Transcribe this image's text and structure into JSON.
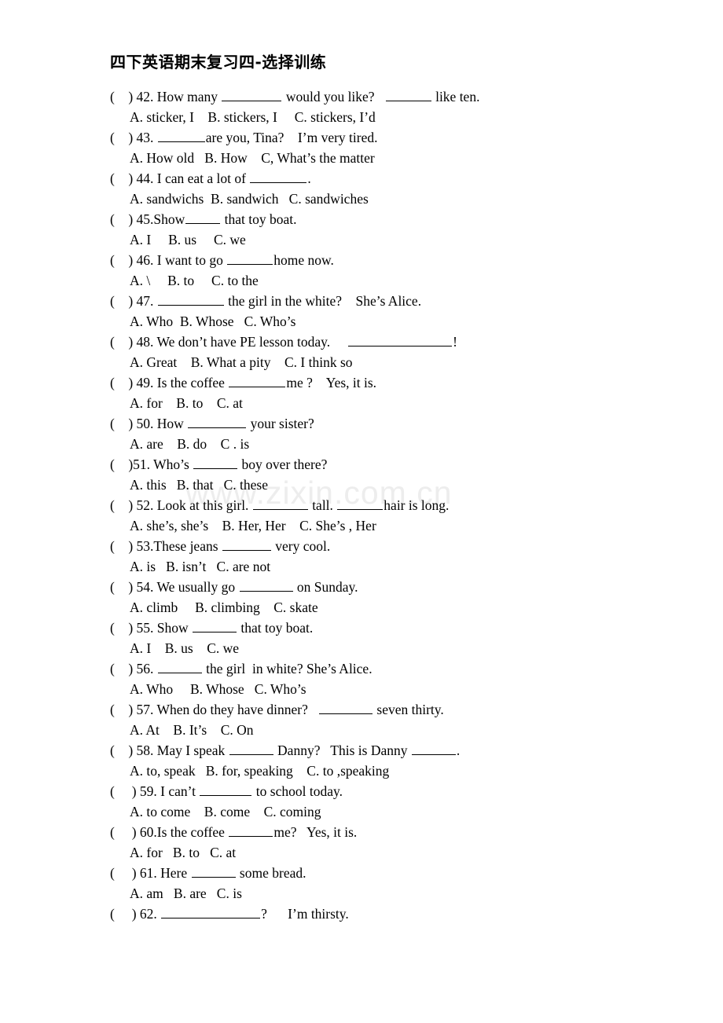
{
  "document": {
    "title": "四下英语期末复习四-选择训练",
    "watermark": "www.zixin.com.cn"
  },
  "questions": [
    {
      "marker": "(    ) ",
      "number": "42. ",
      "stem_a": "How many ",
      "blank1": 76,
      "stem_b": " would you like?   ",
      "blank2": 58,
      "stem_c": " like ten.",
      "options": "A. sticker, I    B. stickers, I     C. stickers, I’d"
    },
    {
      "marker": "(    ) ",
      "number": "43. ",
      "stem_a": "",
      "blank1": 60,
      "stem_b": "are you, Tina?    I’m very tired.",
      "blank2": 0,
      "stem_c": "",
      "options": "A. How old   B. How    C, What’s the matter"
    },
    {
      "marker": "(    ) ",
      "number": "44. ",
      "stem_a": "I can eat a lot of ",
      "blank1": 72,
      "stem_b": ".",
      "blank2": 0,
      "stem_c": "",
      "options": "A. sandwichs  B. sandwich   C. sandwiches"
    },
    {
      "marker": "(    ) ",
      "number": "45.",
      "stem_a": "Show",
      "blank1": 44,
      "stem_b": " that toy boat.",
      "blank2": 0,
      "stem_c": "",
      "options": "A. I     B. us     C. we"
    },
    {
      "marker": "(    ) ",
      "number": "46. ",
      "stem_a": "I want to go ",
      "blank1": 58,
      "stem_b": "home now.",
      "blank2": 0,
      "stem_c": "",
      "options": "A. \\     B. to     C. to the"
    },
    {
      "marker": "(    ) ",
      "number": "47. ",
      "stem_a": "",
      "blank1": 84,
      "stem_b": " the girl in the white?    She’s Alice.",
      "blank2": 0,
      "stem_c": "",
      "options": "A. Who  B. Whose   C. Who’s"
    },
    {
      "marker": "(    ) ",
      "number": "48. ",
      "stem_a": "We don’t have PE lesson today.     ",
      "blank1": 132,
      "stem_b": "!",
      "blank2": 0,
      "stem_c": "",
      "options": "A. Great    B. What a pity    C. I think so"
    },
    {
      "marker": "(    ) ",
      "number": "49. ",
      "stem_a": "Is the coffee ",
      "blank1": 72,
      "stem_b": "me ?    Yes, it is.",
      "blank2": 0,
      "stem_c": "",
      "options": "A. for    B. to    C. at"
    },
    {
      "marker": "(    ) ",
      "number": "50. ",
      "stem_a": "How ",
      "blank1": 74,
      "stem_b": " your sister?",
      "blank2": 0,
      "stem_c": "",
      "options": "A. are    B. do    C . is"
    },
    {
      "marker": "(    )",
      "number": "51. ",
      "stem_a": "Who’s ",
      "blank1": 56,
      "stem_b": " boy over there?",
      "blank2": 0,
      "stem_c": "",
      "options": "A. this   B. that   C. these"
    },
    {
      "marker": "(    ) ",
      "number": "52. ",
      "stem_a": "Look at this girl. ",
      "blank1": 70,
      "stem_b": " tall. ",
      "blank2": 58,
      "stem_c": "hair is long.",
      "options": "A. she’s, she’s    B. Her, Her    C. She’s , Her"
    },
    {
      "marker": "(    ) ",
      "number": "53.",
      "stem_a": "These jeans ",
      "blank1": 62,
      "stem_b": " very cool.",
      "blank2": 0,
      "stem_c": "",
      "options": "A. is   B. isn’t   C. are not"
    },
    {
      "marker": "(    ) ",
      "number": "54. ",
      "stem_a": "We usually go ",
      "blank1": 68,
      "stem_b": " on Sunday.",
      "blank2": 0,
      "stem_c": "",
      "options": "A. climb     B. climbing    C. skate"
    },
    {
      "marker": "(    ) ",
      "number": "55. ",
      "stem_a": "Show ",
      "blank1": 56,
      "stem_b": " that toy boat.",
      "blank2": 0,
      "stem_c": "",
      "options": "A. I    B. us    C. we"
    },
    {
      "marker": "(    ) ",
      "number": "56. ",
      "stem_a": "",
      "blank1": 56,
      "stem_b": " the girl  in white? She’s Alice.",
      "blank2": 0,
      "stem_c": "",
      "options": "A. Who     B. Whose   C. Who’s"
    },
    {
      "marker": "(    ) ",
      "number": "57. ",
      "stem_a": "When do they have dinner?   ",
      "blank1": 68,
      "stem_b": " seven thirty.",
      "blank2": 0,
      "stem_c": "",
      "options": "A. At    B. It’s    C. On"
    },
    {
      "marker": "(    ) ",
      "number": "58. ",
      "stem_a": "May I speak ",
      "blank1": 56,
      "stem_b": " Danny?   This is Danny ",
      "blank2": 56,
      "stem_c": ".",
      "options": "A. to, speak   B. for, speaking    C. to ,speaking"
    },
    {
      "marker": "(     ) ",
      "number": "59. ",
      "stem_a": "I can’t ",
      "blank1": 66,
      "stem_b": " to school today.",
      "blank2": 0,
      "stem_c": "",
      "options": "A. to come    B. come    C. coming"
    },
    {
      "marker": "(     ) ",
      "number": "60.",
      "stem_a": "Is the coffee ",
      "blank1": 56,
      "stem_b": "me?   Yes, it is.",
      "blank2": 0,
      "stem_c": "",
      "options": "A. for   B. to   C. at"
    },
    {
      "marker": "(     ) ",
      "number": "61. ",
      "stem_a": "Here ",
      "blank1": 56,
      "stem_b": " some bread.",
      "blank2": 0,
      "stem_c": "",
      "options": "A. am   B. are   C. is"
    },
    {
      "marker": "(     ) ",
      "number": "62. ",
      "stem_a": "",
      "blank1": 126,
      "stem_b": "?      I’m thirsty.",
      "blank2": 0,
      "stem_c": "",
      "options": ""
    }
  ]
}
